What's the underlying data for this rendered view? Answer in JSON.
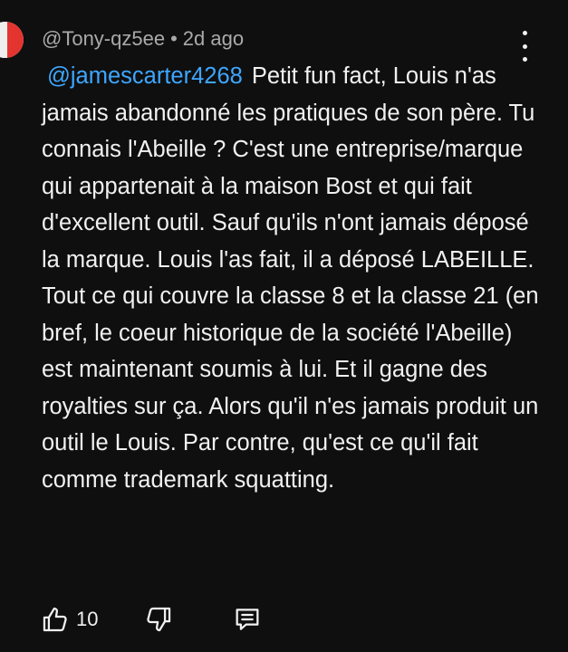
{
  "comment": {
    "author": "@Tony-qz5ee",
    "separator": "•",
    "time_ago": "2d ago",
    "mention": "@jamescarter4268",
    "text": "Petit fun fact, Louis n'as jamais abandonné les pratiques de son père. Tu connais l'Abeille ? C'est une entreprise/marque qui appartenait à la maison Bost et qui fait d'excellent outil. Sauf qu'ils n'ont jamais déposé la marque. Louis l'as fait, il a déposé LABEILLE. Tout ce qui couvre la classe 8 et la classe 21 (en bref, le coeur historique de la société l'Abeille) est maintenant soumis à lui. Et il gagne des royalties sur ça. Alors qu'il n'es jamais produit un outil le Louis. Par contre, qu'est ce qu'il fait comme trademark squatting.",
    "like_count": "10"
  },
  "icons": {
    "menu": "more-vertical-icon",
    "like": "thumb-up-icon",
    "dislike": "thumb-down-icon",
    "reply": "comment-reply-icon",
    "avatar": "flag-avatar"
  },
  "colors": {
    "background": "#0f0f0f",
    "text": "#f1f1f1",
    "meta": "#aaaaaa",
    "mention": "#3ea6ff"
  }
}
